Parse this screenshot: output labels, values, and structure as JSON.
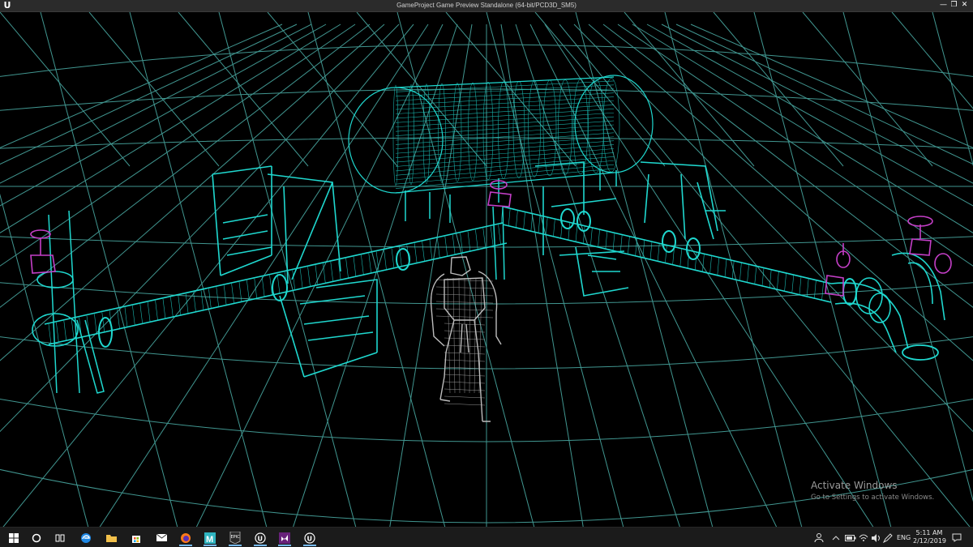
{
  "window": {
    "title": "GameProject Game Preview Standalone (64-bit/PCD3D_SM5)",
    "app_icon": "unreal-engine-icon",
    "minimize_glyph": "—",
    "maximize_glyph": "❐",
    "close_glyph": "✕"
  },
  "viewport": {
    "mode": "wireframe",
    "colors": {
      "grid": "#57c9c1",
      "pipes": "#1fd8cf",
      "valves": "#c53fc8",
      "character": "#bdbdbd",
      "background": "#000000"
    }
  },
  "watermark": {
    "title": "Activate Windows",
    "subtitle": "Go to Settings to activate Windows."
  },
  "taskbar": {
    "apps": [
      {
        "name": "start-button",
        "icon": "windows-logo-icon"
      },
      {
        "name": "cortana-button",
        "icon": "cortana-circle-icon"
      },
      {
        "name": "task-view-button",
        "icon": "task-view-icon"
      },
      {
        "name": "edge-app",
        "icon": "edge-icon"
      },
      {
        "name": "file-explorer-app",
        "icon": "folder-icon"
      },
      {
        "name": "store-app",
        "icon": "store-bag-icon"
      },
      {
        "name": "mail-app",
        "icon": "mail-icon"
      },
      {
        "name": "firefox-app",
        "icon": "firefox-icon"
      },
      {
        "name": "maya-app",
        "icon": "maya-icon"
      },
      {
        "name": "epic-launcher-app",
        "icon": "epic-games-icon"
      },
      {
        "name": "unreal-editor-app",
        "icon": "unreal-engine-icon"
      },
      {
        "name": "visual-studio-app",
        "icon": "visual-studio-icon"
      },
      {
        "name": "unreal-game-app",
        "icon": "unreal-engine-icon"
      }
    ],
    "epic_label": "EPIC",
    "tray": {
      "language": "ENG",
      "time": "5:11 AM",
      "date": "2/12/2019"
    }
  }
}
